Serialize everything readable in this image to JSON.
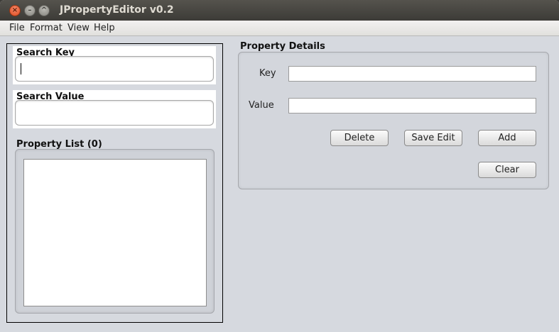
{
  "window": {
    "title": "JPropertyEditor v0.2",
    "controls": {
      "close": "×",
      "minimize": "–",
      "maximize": "^"
    }
  },
  "menubar": {
    "items": [
      "File",
      "Format",
      "View",
      "Help"
    ]
  },
  "left_panel": {
    "search_key": {
      "label": "Search Key",
      "value": ""
    },
    "search_value": {
      "label": "Search Value",
      "value": ""
    },
    "property_list": {
      "label": "Property List (0)",
      "items": []
    }
  },
  "details": {
    "title": "Property Details",
    "key_label": "Key",
    "key_value": "",
    "value_label": "Value",
    "value_value": "",
    "buttons": {
      "delete": "Delete",
      "save_edit": "Save Edit",
      "add": "Add",
      "clear": "Clear"
    }
  }
}
